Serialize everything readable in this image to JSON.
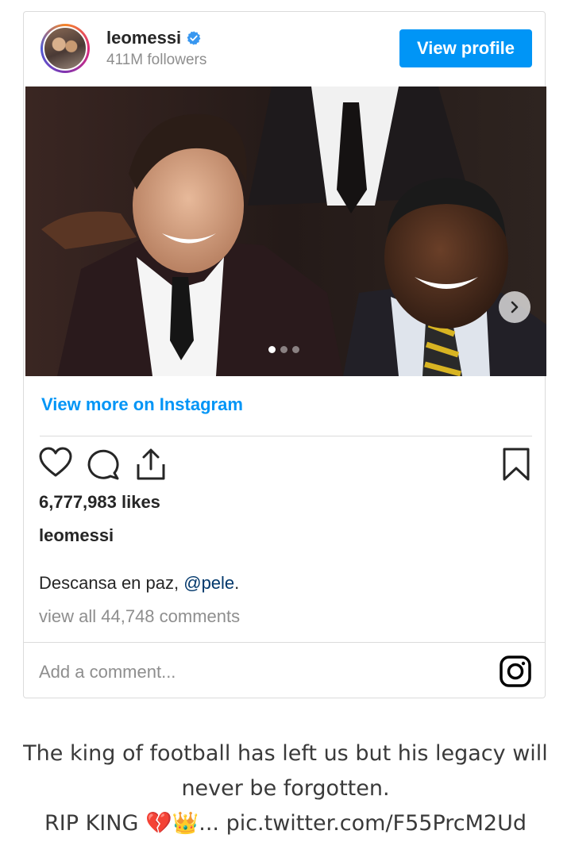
{
  "profile": {
    "username": "leomessi",
    "followers": "411M followers",
    "view_profile_label": "View profile"
  },
  "post": {
    "view_more_label": "View more on Instagram",
    "likes": "6,777,983 likes",
    "username": "leomessi",
    "caption_text": "Descansa en paz, ",
    "caption_mention": "@pele",
    "caption_end": ".",
    "comments_link": "view all 44,748 comments",
    "add_comment_placeholder": "Add a comment...",
    "carousel": {
      "total": 3,
      "active_index": 0
    }
  },
  "tweet": {
    "line1": "The king of football has left us but his legacy will",
    "line2": "never be forgotten.",
    "line3_text": "RIP KING ",
    "line3_emoji": "💔👑",
    "line3_rest": "... pic.twitter.com/F55PrcM2Ud"
  },
  "colors": {
    "brand_blue": "#0095f6",
    "mention_blue": "#00376b",
    "muted_gray": "#8e8e8e",
    "border": "#dbdbdb"
  },
  "icons": {
    "verified": "verified-badge-icon",
    "like": "heart-icon",
    "comment": "comment-bubble-icon",
    "share": "share-icon",
    "save": "bookmark-icon",
    "next": "chevron-right-icon",
    "instagram": "instagram-logo-icon"
  }
}
